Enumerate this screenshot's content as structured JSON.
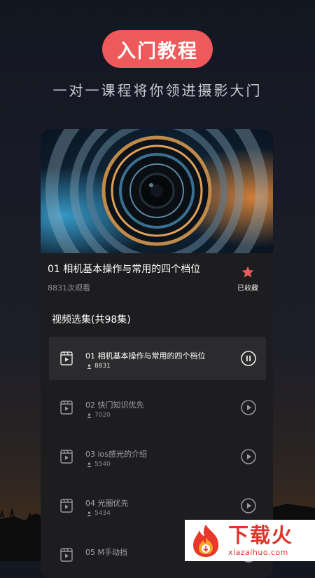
{
  "hero": {
    "badge": "入门教程",
    "subtitle": "一对一课程将你领进摄影大门"
  },
  "course": {
    "title": "01 相机基本操作与常用的四个档位",
    "views": "8831次观看",
    "favorite_label": "已收藏"
  },
  "episodes_section": {
    "title": "视频选集(共98集)",
    "items": [
      {
        "name": "01 相机基本操作与常用的四个档位",
        "count": "8831",
        "state": "playing"
      },
      {
        "name": "02 快门知识优先",
        "count": "7020",
        "state": "idle"
      },
      {
        "name": "03 ios感光的介绍",
        "count": "5540",
        "state": "idle"
      },
      {
        "name": "04 光圈优先",
        "count": "5434",
        "state": "idle"
      },
      {
        "name": "05 M手动挡",
        "count": "",
        "state": "idle"
      }
    ]
  },
  "watermark": {
    "brand": "下载火",
    "domain": "xiazaihuo.com"
  },
  "colors": {
    "accent": "#ee5a5c",
    "card": "#1d1d1f",
    "active_row": "#2b2b2d"
  },
  "icons": [
    "video-file-icon",
    "pause-icon",
    "play-icon",
    "star-icon",
    "user-icon"
  ]
}
